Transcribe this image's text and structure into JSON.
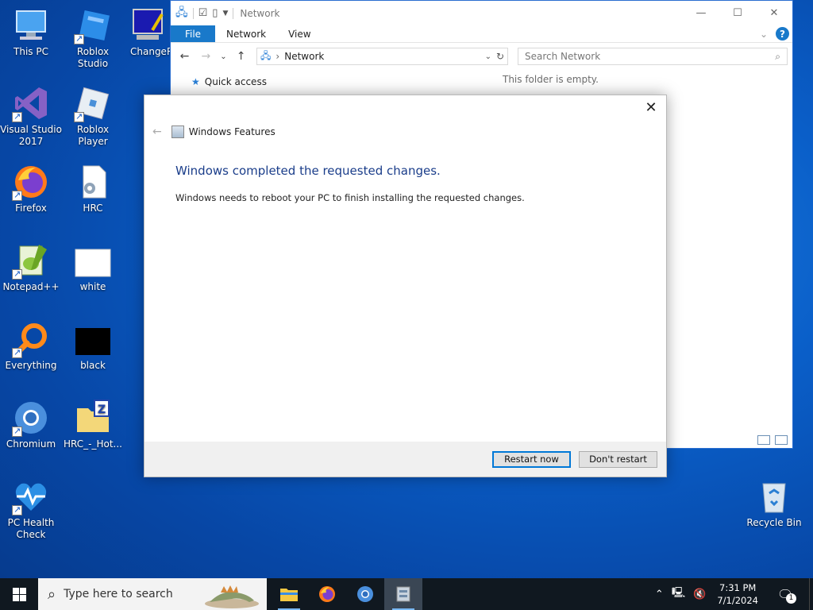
{
  "desktop": {
    "icons": [
      {
        "label": "This PC"
      },
      {
        "label": "Roblox Studio"
      },
      {
        "label": "ChangeR"
      },
      {
        "label": "Visual Studio 2017"
      },
      {
        "label": "Roblox Player"
      },
      {
        "label": "Firefox"
      },
      {
        "label": "HRC"
      },
      {
        "label": "Notepad++"
      },
      {
        "label": "white"
      },
      {
        "label": "Everything"
      },
      {
        "label": "black"
      },
      {
        "label": "Chromium"
      },
      {
        "label": "HRC_-_Hot..."
      },
      {
        "label": "PC Health Check"
      },
      {
        "label": "Recycle Bin"
      }
    ]
  },
  "explorer": {
    "title": "Network",
    "ribbon_tabs": [
      "File",
      "Network",
      "View"
    ],
    "address": "Network",
    "search_placeholder": "Search Network",
    "quick_access": "Quick access",
    "empty_message": "This folder is empty."
  },
  "dialog": {
    "app_name": "Windows Features",
    "heading": "Windows completed the requested changes.",
    "message": "Windows needs to reboot your PC to finish installing the requested changes.",
    "restart_label": "Restart now",
    "dont_restart_label": "Don't restart"
  },
  "taskbar": {
    "search_placeholder": "Type here to search",
    "time": "7:31 PM",
    "date": "7/1/2024",
    "notification_count": "1"
  },
  "colors": {
    "accent": "#0078d7",
    "heading": "#1a3d8a",
    "file_tab": "#1979ca",
    "taskbar": "#101820"
  }
}
